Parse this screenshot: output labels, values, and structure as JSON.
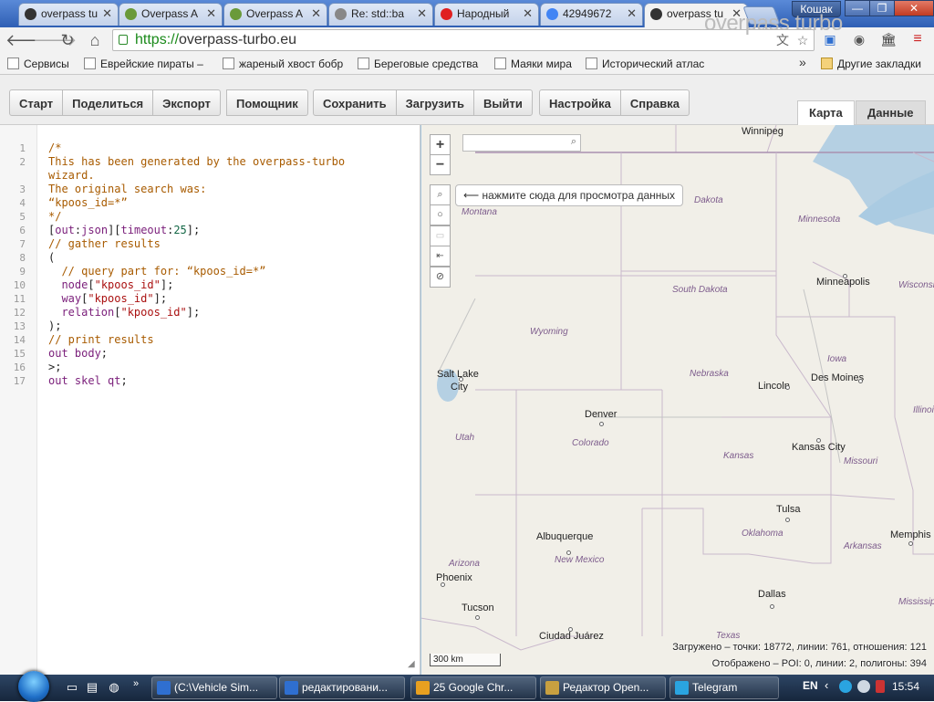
{
  "browser": {
    "tabs": [
      {
        "label": "overpass tu",
        "icon": "steering-wheel-icon",
        "color": "#333333"
      },
      {
        "label": "Overpass A",
        "icon": "overpass-leaf-icon",
        "color": "#6a9a3a"
      },
      {
        "label": "Overpass A",
        "icon": "overpass-leaf-icon",
        "color": "#6a9a3a"
      },
      {
        "label": "Re: std::ba",
        "icon": "page-icon",
        "color": "#888888"
      },
      {
        "label": "Народный",
        "icon": "yandex-icon",
        "color": "#e02020"
      },
      {
        "label": "42949672",
        "icon": "google-icon",
        "color": "#4285f4"
      },
      {
        "label": "overpass tu",
        "icon": "steering-wheel-icon",
        "color": "#333333",
        "active": true
      }
    ],
    "close_glyph": "✕",
    "profile_name": "Кошак",
    "window_buttons": {
      "minimize": "—",
      "restore": "❐",
      "close": "✕"
    },
    "url_scheme": "https://",
    "url_host": "overpass-turbo.eu",
    "bookmarks": [
      {
        "label": "Сервисы",
        "icon": "apps-grid-icon"
      },
      {
        "label": "Еврейские пираты –",
        "icon": "wikipedia-icon"
      },
      {
        "label": "жареный хвост бобр",
        "icon": "page-icon"
      },
      {
        "label": "Береговые средства",
        "icon": "abc-icon"
      },
      {
        "label": "Маяки мира",
        "icon": "page-icon"
      },
      {
        "label": "Исторический атлас",
        "icon": "atlas-icon"
      }
    ],
    "bookmarks_overflow": "»",
    "other_bookmarks": "Другие закладки"
  },
  "app": {
    "toolbar_groups": [
      [
        "Старт",
        "Поделиться",
        "Экспорт"
      ],
      [
        "Помощник"
      ],
      [
        "Сохранить",
        "Загрузить",
        "Выйти"
      ],
      [
        "Настройка",
        "Справка"
      ]
    ],
    "brand": "overpass turbo",
    "view_tabs": {
      "map": "Карта",
      "data": "Данные"
    },
    "code_lines": [
      [
        {
          "t": "/*",
          "c": "comment"
        }
      ],
      [
        {
          "t": "This has been generated by the overpass-turbo",
          "c": "comment"
        }
      ],
      [
        {
          "t": "wizard.",
          "c": "comment"
        }
      ],
      [
        {
          "t": "The original search was:",
          "c": "comment"
        }
      ],
      [
        {
          "t": "“kpoos_id=*”",
          "c": "comment"
        }
      ],
      [
        {
          "t": "*/",
          "c": "comment"
        }
      ],
      [
        {
          "t": "[",
          "c": "plain"
        },
        {
          "t": "out",
          "c": "kw"
        },
        {
          "t": ":",
          "c": "plain"
        },
        {
          "t": "json",
          "c": "kw"
        },
        {
          "t": "][",
          "c": "plain"
        },
        {
          "t": "timeout",
          "c": "kw"
        },
        {
          "t": ":",
          "c": "plain"
        },
        {
          "t": "25",
          "c": "num"
        },
        {
          "t": "];",
          "c": "plain"
        }
      ],
      [
        {
          "t": "// gather results",
          "c": "comment"
        }
      ],
      [
        {
          "t": "(",
          "c": "plain"
        }
      ],
      [
        {
          "t": "  // query part for: “kpoos_id=*”",
          "c": "comment"
        }
      ],
      [
        {
          "t": "  node",
          "c": "kw"
        },
        {
          "t": "[",
          "c": "plain"
        },
        {
          "t": "\"kpoos_id\"",
          "c": "str"
        },
        {
          "t": "];",
          "c": "plain"
        }
      ],
      [
        {
          "t": "  way",
          "c": "kw"
        },
        {
          "t": "[",
          "c": "plain"
        },
        {
          "t": "\"kpoos_id\"",
          "c": "str"
        },
        {
          "t": "];",
          "c": "plain"
        }
      ],
      [
        {
          "t": "  relation",
          "c": "kw"
        },
        {
          "t": "[",
          "c": "plain"
        },
        {
          "t": "\"kpoos_id\"",
          "c": "str"
        },
        {
          "t": "];",
          "c": "plain"
        }
      ],
      [
        {
          "t": ");",
          "c": "plain"
        }
      ],
      [
        {
          "t": "// print results",
          "c": "comment"
        }
      ],
      [
        {
          "t": "out body",
          "c": "kw"
        },
        {
          "t": ";",
          "c": "plain"
        }
      ],
      [
        {
          "t": ">;",
          "c": "plain"
        }
      ],
      [
        {
          "t": "out skel qt",
          "c": "kw"
        },
        {
          "t": ";",
          "c": "plain"
        }
      ]
    ],
    "line_numbers": [
      "1",
      "2",
      "",
      "3",
      "4",
      "5",
      "6",
      "7",
      "8",
      "9",
      "10",
      "11",
      "12",
      "13",
      "14",
      "15",
      "16",
      "17"
    ]
  },
  "map": {
    "zoom_in": "+",
    "zoom_out": "−",
    "hint": "⟵ нажмите сюда для просмотра данных",
    "cities": [
      {
        "name": "Winnipeg"
      },
      {
        "name": "Minneapolis"
      },
      {
        "name": "Salt Lake"
      },
      {
        "name": "City"
      },
      {
        "name": "Denver"
      },
      {
        "name": "Lincoln"
      },
      {
        "name": "Des Moines"
      },
      {
        "name": "Kansas City"
      },
      {
        "name": "Tulsa"
      },
      {
        "name": "Albuquerque"
      },
      {
        "name": "Memphis"
      },
      {
        "name": "Phoenix"
      },
      {
        "name": "Tucson"
      },
      {
        "name": "Dallas"
      },
      {
        "name": "Ciudad Juárez"
      }
    ],
    "states": [
      {
        "name": "Montana"
      },
      {
        "name": "Dakota"
      },
      {
        "name": "Minnesota"
      },
      {
        "name": "South Dakota"
      },
      {
        "name": "Wisconsi"
      },
      {
        "name": "Wyoming"
      },
      {
        "name": "Iowa"
      },
      {
        "name": "Nebraska"
      },
      {
        "name": "Illinoi"
      },
      {
        "name": "Utah"
      },
      {
        "name": "Colorado"
      },
      {
        "name": "Kansas"
      },
      {
        "name": "Missouri"
      },
      {
        "name": "Oklahoma"
      },
      {
        "name": "Arkansas"
      },
      {
        "name": "Arizona"
      },
      {
        "name": "New Mexico"
      },
      {
        "name": "Mississipp"
      },
      {
        "name": "Texas"
      }
    ],
    "scale": "300 km",
    "stats_loaded": "Загружено – точки: 18772, линии: 761, отношения: 121",
    "stats_shown": "Отображено – POI: 0, линии: 2, полигоны: 394"
  },
  "taskbar": {
    "tasks": [
      {
        "label": "(C:\\Vehicle Sim...",
        "icon": "window-icon"
      },
      {
        "label": "редактировани...",
        "icon": "window-icon"
      },
      {
        "label": "25 Google Chr...",
        "icon": "chrome-icon"
      },
      {
        "label": "Редактор Open...",
        "icon": "pencil-icon"
      },
      {
        "label": "Telegram",
        "icon": "telegram-icon"
      }
    ],
    "lang": "EN",
    "clock": "15:54"
  }
}
